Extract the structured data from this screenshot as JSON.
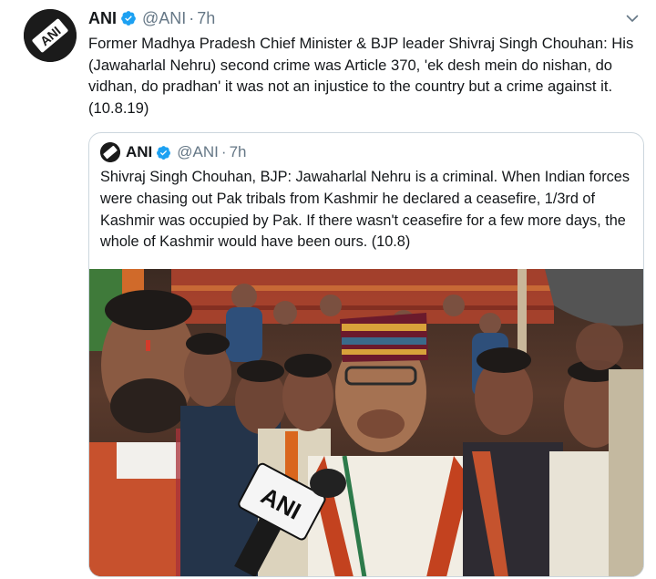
{
  "tweet": {
    "author_name": "ANI",
    "author_handle": "@ANI",
    "separator": "·",
    "time": "7h",
    "text": "Former Madhya Pradesh Chief Minister & BJP leader Shivraj Singh Chouhan: His (Jawaharlal Nehru) second crime was Article 370, 'ek desh mein do nishan, do vidhan, do pradhan' it was not an injustice to the country but a crime against it. (10.8.19)",
    "logo_text": "ANI"
  },
  "quoted_tweet": {
    "author_name": "ANI",
    "author_handle": "@ANI",
    "separator": "·",
    "time": "7h",
    "text": "Shivraj Singh Chouhan, BJP: Jawaharlal Nehru is a criminal. When Indian forces were chasing out Pak tribals from Kashmir he declared a ceasefire, 1/3rd of Kashmir was occupied by Pak. If there wasn't ceasefire for a few more days, the whole of Kashmir would have been ours. (10.8)",
    "media_mic_label": "ANI"
  },
  "icons": {
    "verified": "verified-badge-icon",
    "menu": "chevron-down-icon"
  },
  "colors": {
    "verified_blue": "#1da1f2",
    "secondary_text": "#657786",
    "border": "#ccd6dd"
  }
}
